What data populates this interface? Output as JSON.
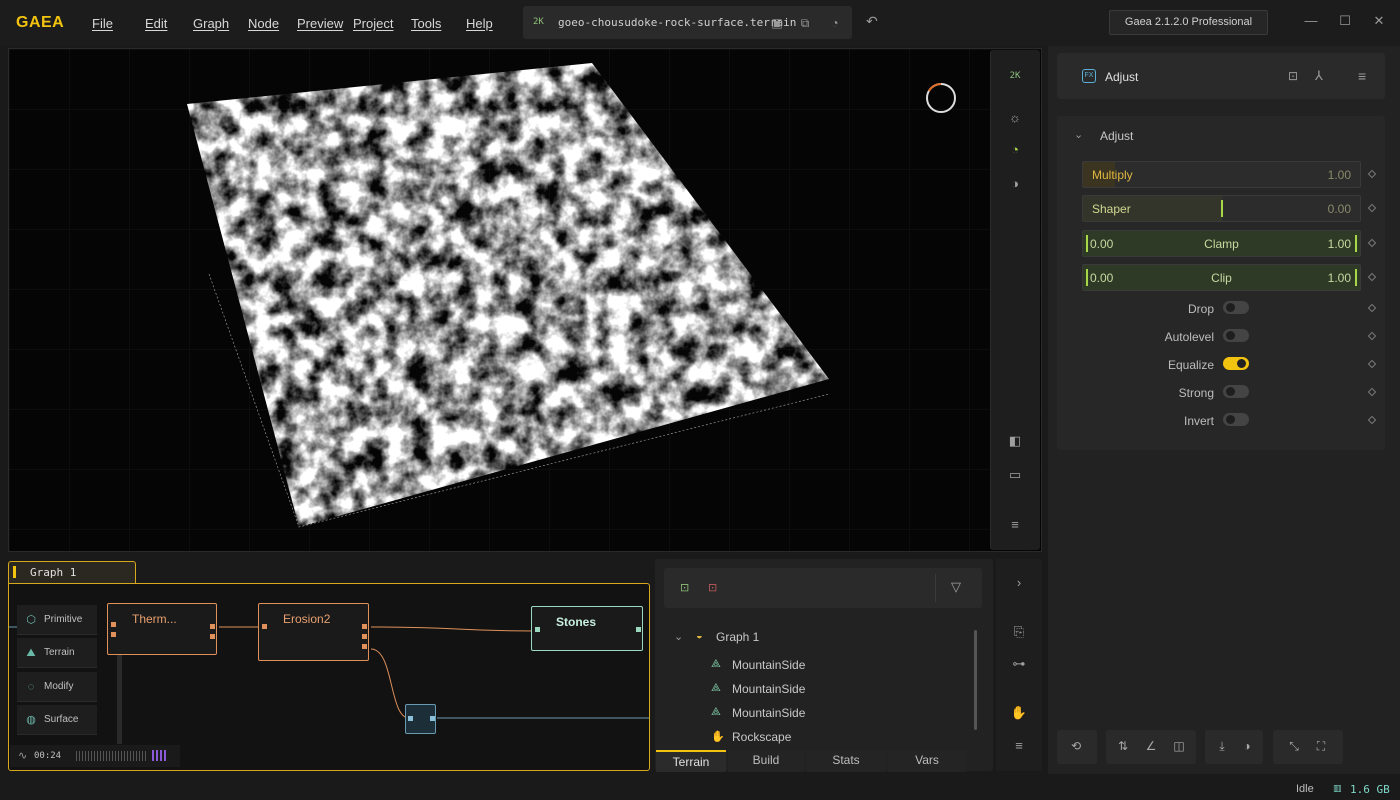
{
  "app": {
    "logo": "GAEA",
    "version": "Gaea 2.1.2.0 Professional",
    "file": {
      "resolution": "2K",
      "name": "goeo-chousudoke-rock-surface.terrain"
    }
  },
  "menu": [
    "File",
    "Edit",
    "Graph",
    "Node",
    "Preview",
    "Project",
    "Tools",
    "Help"
  ],
  "viewport": {
    "toolbar_resolution": "2K"
  },
  "properties": {
    "node_title": "Adjust",
    "fx_badge": "FX",
    "section_title": "Adjust",
    "sliders": [
      {
        "label": "Multiply",
        "value": "1.00"
      },
      {
        "label": "Shaper",
        "value": "0.00"
      }
    ],
    "ranges": [
      {
        "label": "Clamp",
        "low": "0.00",
        "high": "1.00"
      },
      {
        "label": "Clip",
        "low": "0.00",
        "high": "1.00"
      }
    ],
    "toggles": [
      {
        "label": "Drop",
        "on": false
      },
      {
        "label": "Autolevel",
        "on": false
      },
      {
        "label": "Equalize",
        "on": true
      },
      {
        "label": "Strong",
        "on": false
      },
      {
        "label": "Invert",
        "on": false
      }
    ]
  },
  "graph": {
    "tab_label": "Graph 1",
    "categories": [
      "Primitive",
      "Terrain",
      "Modify",
      "Surface"
    ],
    "nodes": [
      {
        "label": "Therm...",
        "color": "#e0905a"
      },
      {
        "label": "Erosion2",
        "color": "#e0905a"
      },
      {
        "label": "Stones",
        "color": "#9ad8c0"
      }
    ],
    "timer": "00:24"
  },
  "tree": {
    "root": "Graph 1",
    "items": [
      "MountainSide",
      "MountainSide",
      "MountainSide",
      "Rockscape"
    ],
    "tabs": [
      "Terrain",
      "Build",
      "Stats",
      "Vars"
    ]
  },
  "status": {
    "state": "Idle",
    "memory": "1.6 GB"
  },
  "colors": {
    "accent": "#f2c30f",
    "node_border": "#e0905a",
    "output_node": "#9ad8c0"
  }
}
